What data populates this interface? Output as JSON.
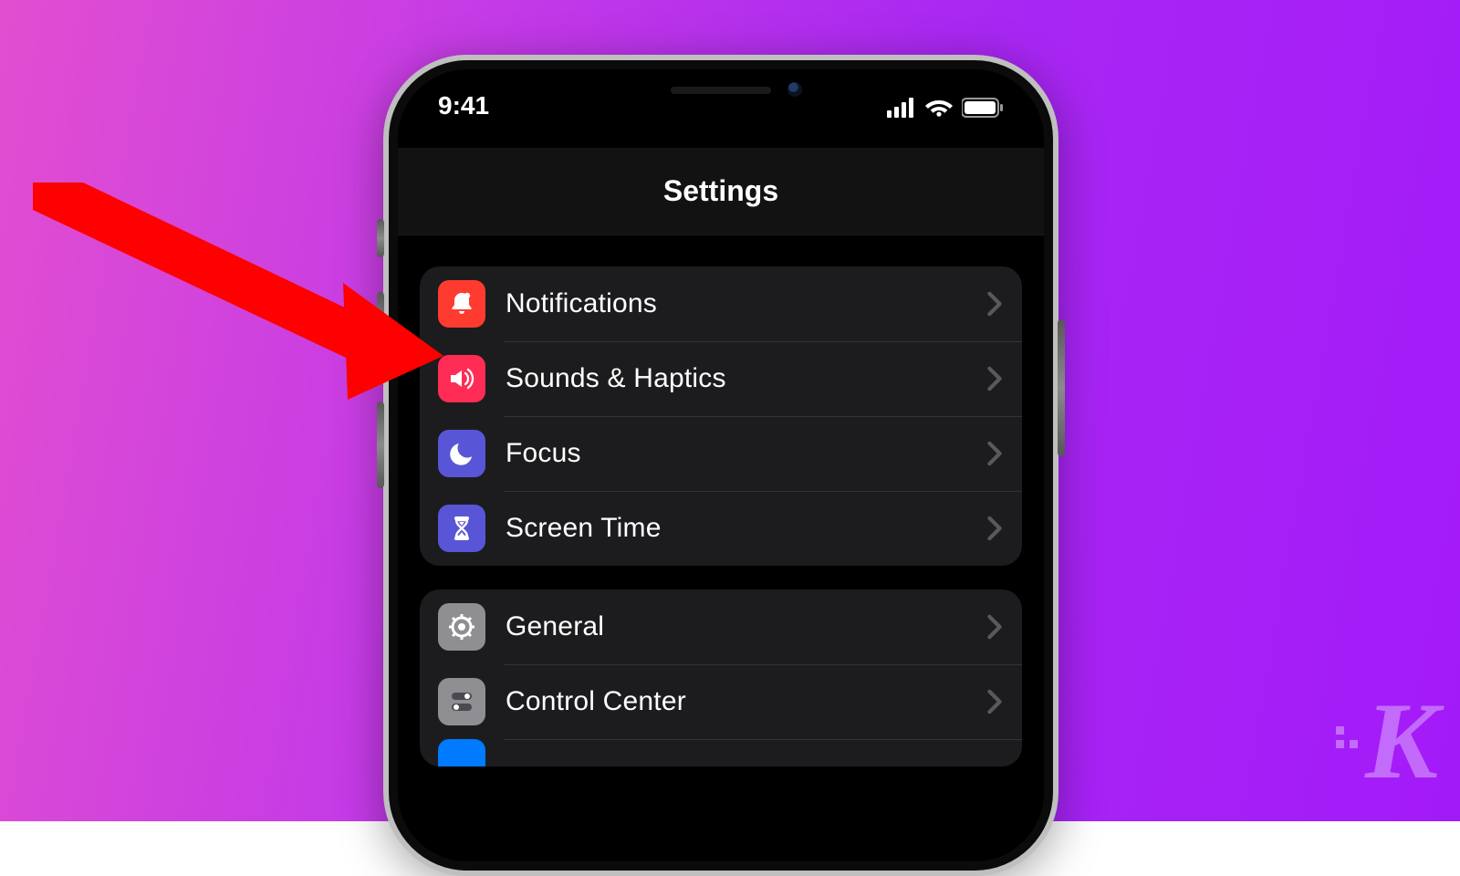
{
  "status": {
    "time": "9:41",
    "signal_icon": "cellular-icon",
    "wifi_icon": "wifi-icon",
    "battery_icon": "battery-icon"
  },
  "header": {
    "title": "Settings"
  },
  "groups": [
    {
      "rows": [
        {
          "icon": "bell-icon",
          "icon_bg": "bg-red",
          "label": "Notifications"
        },
        {
          "icon": "speaker-icon",
          "icon_bg": "bg-pink",
          "label": "Sounds & Haptics"
        },
        {
          "icon": "moon-icon",
          "icon_bg": "bg-indigo",
          "label": "Focus"
        },
        {
          "icon": "hourglass-icon",
          "icon_bg": "bg-indigo",
          "label": "Screen Time"
        }
      ]
    },
    {
      "rows": [
        {
          "icon": "gear-icon",
          "icon_bg": "bg-gray",
          "label": "General"
        },
        {
          "icon": "toggles-icon",
          "icon_bg": "bg-gray",
          "label": "Control Center"
        }
      ]
    }
  ],
  "watermark": {
    "letter": "K"
  },
  "annotation": {
    "arrow_color": "#ff0000"
  }
}
